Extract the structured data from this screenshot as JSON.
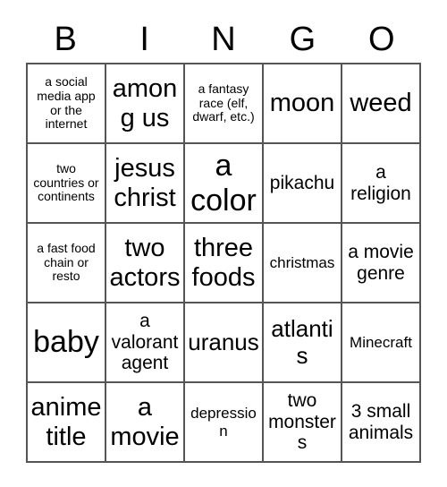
{
  "card": {
    "header": {
      "letters": [
        "B",
        "I",
        "N",
        "G",
        "O"
      ]
    },
    "rows": [
      [
        {
          "text": "a social media app or the internet",
          "size": "xs"
        },
        {
          "text": "among us",
          "size": "xl"
        },
        {
          "text": "a fantasy race (elf, dwarf, etc.)",
          "size": "xs"
        },
        {
          "text": "moon",
          "size": "xl"
        },
        {
          "text": "weed",
          "size": "xl"
        }
      ],
      [
        {
          "text": "two countries or continents",
          "size": "xs"
        },
        {
          "text": "jesus christ",
          "size": "xl"
        },
        {
          "text": "a color",
          "size": "xxl"
        },
        {
          "text": "pikachu",
          "size": "md"
        },
        {
          "text": "a religion",
          "size": "md"
        }
      ],
      [
        {
          "text": "a fast food chain or resto",
          "size": "xs"
        },
        {
          "text": "two actors",
          "size": "xl"
        },
        {
          "text": "three foods",
          "size": "xl"
        },
        {
          "text": "christmas",
          "size": "sm"
        },
        {
          "text": "a movie genre",
          "size": "md"
        }
      ],
      [
        {
          "text": "baby",
          "size": "xxl"
        },
        {
          "text": "a valorant agent",
          "size": "md"
        },
        {
          "text": "uranus",
          "size": "lg"
        },
        {
          "text": "atlantis",
          "size": "lg"
        },
        {
          "text": "Minecraft",
          "size": "sm"
        }
      ],
      [
        {
          "text": "anime title",
          "size": "xl"
        },
        {
          "text": "a movie",
          "size": "xl"
        },
        {
          "text": "depression",
          "size": "sm"
        },
        {
          "text": "two monsters",
          "size": "md"
        },
        {
          "text": "3 small animals",
          "size": "md"
        }
      ]
    ]
  },
  "colors": {
    "text": "#000000",
    "border": "#555555",
    "background": "#ffffff"
  }
}
